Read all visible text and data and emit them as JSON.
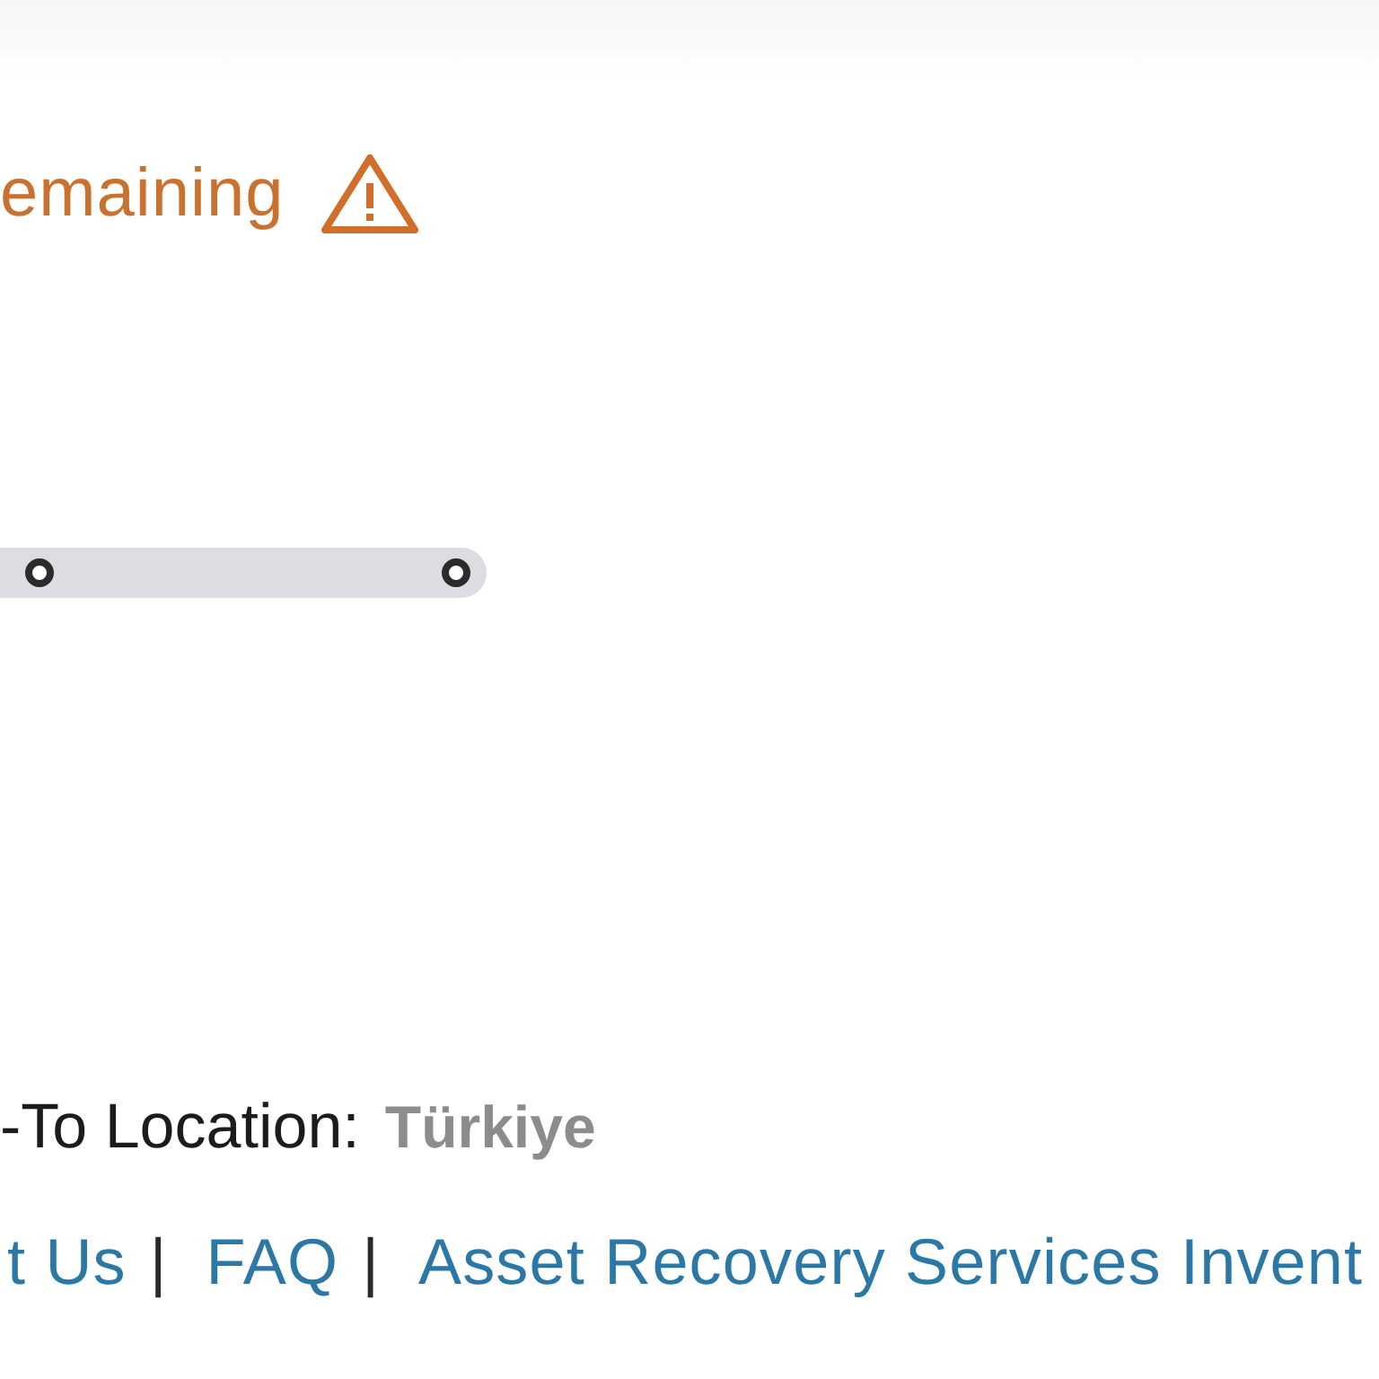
{
  "warning": {
    "text": "emaining"
  },
  "timeline": {
    "markers": [
      {
        "reached": false
      },
      {
        "reached": false
      }
    ]
  },
  "ship_to": {
    "label": "-To Location:",
    "value": "Türkiye"
  },
  "footer": {
    "items": [
      {
        "kind": "link",
        "text": "t Us"
      },
      {
        "kind": "separator",
        "text": "|"
      },
      {
        "kind": "link",
        "text": "FAQ"
      },
      {
        "kind": "separator",
        "text": "|"
      },
      {
        "kind": "link",
        "text": "Asset Recovery Services Invent"
      }
    ]
  }
}
